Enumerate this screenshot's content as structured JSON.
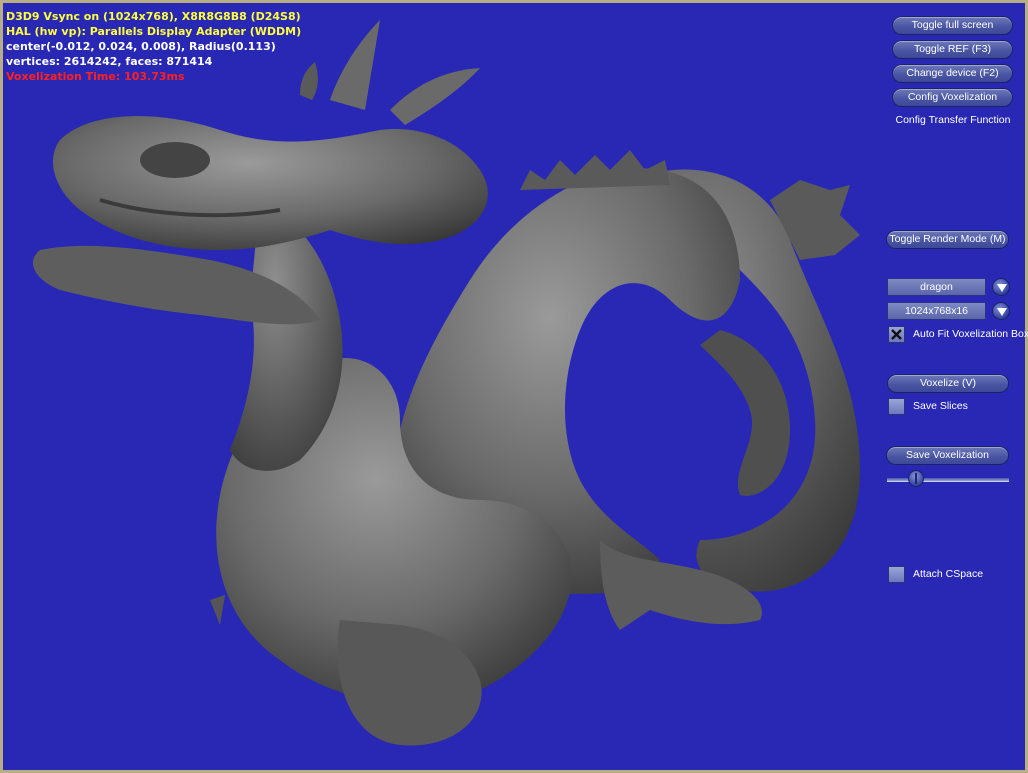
{
  "stats": {
    "line1": "D3D9 Vsync on (1024x768), X8R8G8B8 (D24S8)",
    "line2": "HAL (hw vp): Parallels Display Adapter (WDDM)",
    "line3": "center(-0.012, 0.024, 0.008), Radius(0.113)",
    "line4": "vertices: 2614242, faces: 871414",
    "line5": "Voxelization Time: 103.73ms"
  },
  "buttons": {
    "toggle_full_screen": "Toggle full screen",
    "toggle_ref": "Toggle REF (F3)",
    "change_device": "Change device (F2)",
    "config_voxelization": "Config Voxelization",
    "config_transfer_function": "Config Transfer Function",
    "toggle_render_mode": "Toggle Render Mode (M)",
    "voxelize": "Voxelize (V)",
    "save_voxelization": "Save Voxelization"
  },
  "model_select": {
    "value": "dragon"
  },
  "resolution_select": {
    "value": "1024x768x16"
  },
  "checkboxes": {
    "auto_fit": {
      "label": "Auto Fit Voxelization Box",
      "checked": true
    },
    "save_slices": {
      "label": "Save Slices",
      "checked": false
    },
    "attach_cspace": {
      "label": "Attach CSpace",
      "checked": false
    }
  },
  "slider": {
    "value": 0.2
  },
  "colors": {
    "background": "#2828b4",
    "stats_yellow": "#ffff40",
    "stats_white": "#ffffff",
    "stats_red": "#ff2020",
    "model_gray": "#6a6a6a"
  },
  "icons": {
    "combo_arrow": "chevron-down-icon",
    "checked_mark": "x-mark-icon"
  }
}
